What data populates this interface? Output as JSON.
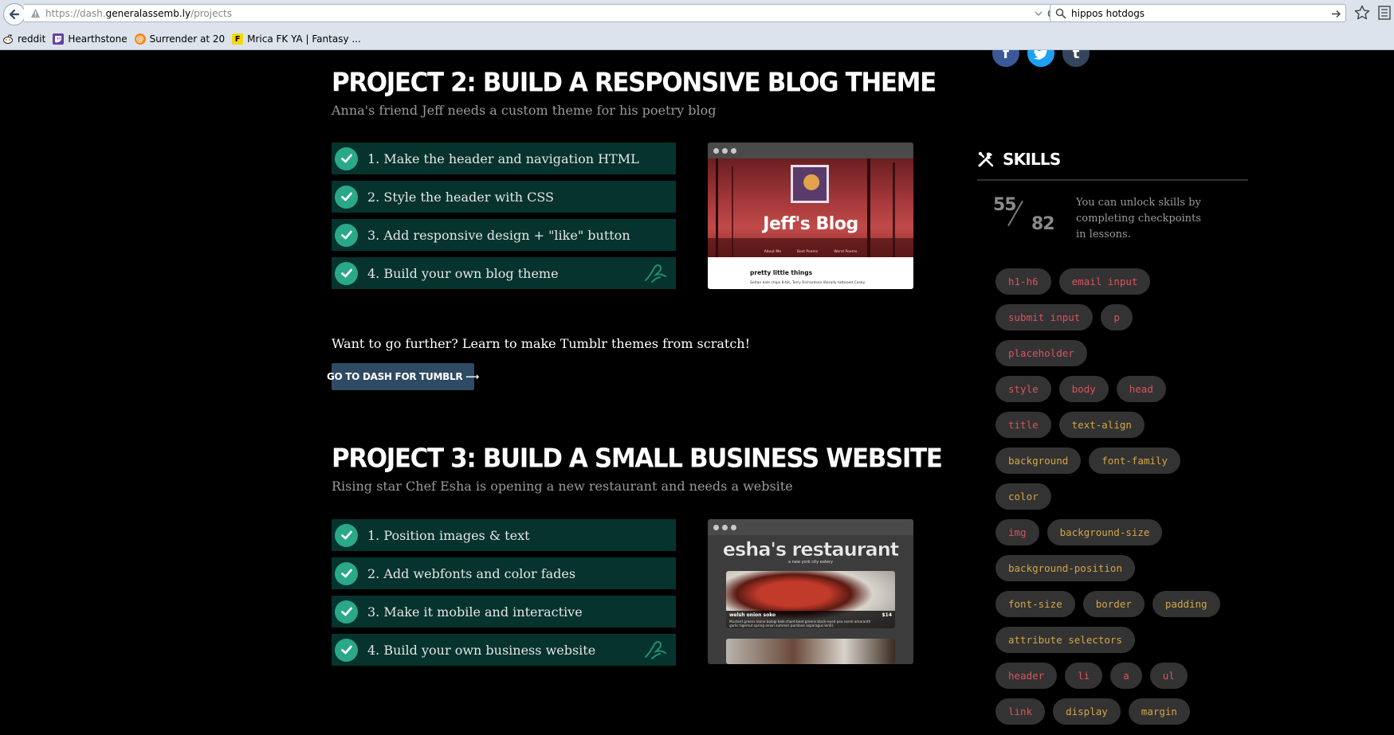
{
  "browser": {
    "url_prefix": "https://dash.",
    "url_domain": "generalassemb.ly",
    "url_path": "/projects",
    "search_text": "hippos hotdogs",
    "bookmarks": [
      {
        "label": "reddit",
        "icon": "reddit-icon"
      },
      {
        "label": "Hearthstone",
        "icon": "twitch-icon"
      },
      {
        "label": "Surrender at 20",
        "icon": "surrender-icon"
      },
      {
        "label": "Mrica FK YA | Fantasy ...",
        "icon": "fantasy-icon"
      }
    ]
  },
  "project2": {
    "title": "PROJECT 2: BUILD A RESPONSIVE BLOG THEME",
    "subtitle": "Anna's friend Jeff needs a custom theme for his poetry blog",
    "steps": [
      {
        "label": "1. Make the header and navigation HTML"
      },
      {
        "label": "2. Style the header with CSS"
      },
      {
        "label": "3. Add responsive design + \"like\" button"
      },
      {
        "label": "4. Build your own blog theme"
      }
    ],
    "preview": {
      "blog_name": "Jeff's Blog",
      "nav": [
        "About Me",
        "Best Poems",
        "Worst Poems"
      ],
      "post_title": "pretty little things",
      "post_text": "Seitan kale chips 8-bit, Terry Richardson literally tattooed Cosby"
    }
  },
  "further": {
    "text": "Want to go further? Learn to make Tumblr themes from scratch!",
    "button": "GO TO DASH FOR TUMBLR ⟶"
  },
  "project3": {
    "title": "PROJECT 3: BUILD A SMALL BUSINESS WEBSITE",
    "subtitle": "Rising star Chef Esha is opening a new restaurant and needs a website",
    "steps": [
      {
        "label": "1. Position images & text"
      },
      {
        "label": "2. Add webfonts and color fades"
      },
      {
        "label": "3. Make it mobile and interactive"
      },
      {
        "label": "4. Build your own business website"
      }
    ],
    "preview": {
      "restaurant_name": "esha's restaurant",
      "tagline": "a new york city eatery",
      "dish_name": "welsh onion soko",
      "dish_price": "$14",
      "dish_desc_1": "Mustard greens leone bologi kale chard beet greens black-eyed pea sorrel amaranth",
      "dish_desc_2": "garlic tigernut spring onion summer purslane asparagus lentil."
    }
  },
  "sidebar": {
    "skills_title": "SKILLS",
    "skills_done": "55",
    "skills_total": "82",
    "unlock_text": "You can unlock skills by completing checkpoints in lessons.",
    "skill_rows": [
      [
        {
          "label": "h1-h6",
          "color": "red"
        },
        {
          "label": "email input",
          "color": "red"
        }
      ],
      [
        {
          "label": "submit input",
          "color": "red"
        },
        {
          "label": "p",
          "color": "red"
        }
      ],
      [
        {
          "label": "placeholder",
          "color": "red"
        }
      ],
      [
        {
          "label": "style",
          "color": "red"
        },
        {
          "label": "body",
          "color": "red"
        },
        {
          "label": "head",
          "color": "red"
        }
      ],
      [
        {
          "label": "title",
          "color": "red"
        },
        {
          "label": "text-align",
          "color": "gold"
        }
      ],
      [
        {
          "label": "background",
          "color": "gold"
        },
        {
          "label": "font-family",
          "color": "gold"
        }
      ],
      [
        {
          "label": "color",
          "color": "gold"
        }
      ],
      [
        {
          "label": "img",
          "color": "red"
        },
        {
          "label": "background-size",
          "color": "gold"
        }
      ],
      [
        {
          "label": "background-position",
          "color": "gold"
        }
      ],
      [
        {
          "label": "font-size",
          "color": "gold"
        },
        {
          "label": "border",
          "color": "gold"
        },
        {
          "label": "padding",
          "color": "gold"
        }
      ],
      [
        {
          "label": "attribute selectors",
          "color": "gold"
        }
      ],
      [
        {
          "label": "header",
          "color": "red"
        },
        {
          "label": "li",
          "color": "red"
        },
        {
          "label": "a",
          "color": "red"
        },
        {
          "label": "ul",
          "color": "red"
        }
      ],
      [
        {
          "label": "link",
          "color": "red"
        },
        {
          "label": "display",
          "color": "gold"
        },
        {
          "label": "margin",
          "color": "gold"
        }
      ]
    ]
  },
  "colors": {
    "step_bg": "#06332d",
    "check": "#2aa88a",
    "tag_red": "#d8545d",
    "tag_gold": "#d3a648",
    "button": "#2f4a63",
    "facebook": "#3b5998",
    "twitter": "#1da1f2",
    "tumblr": "#35465c"
  }
}
